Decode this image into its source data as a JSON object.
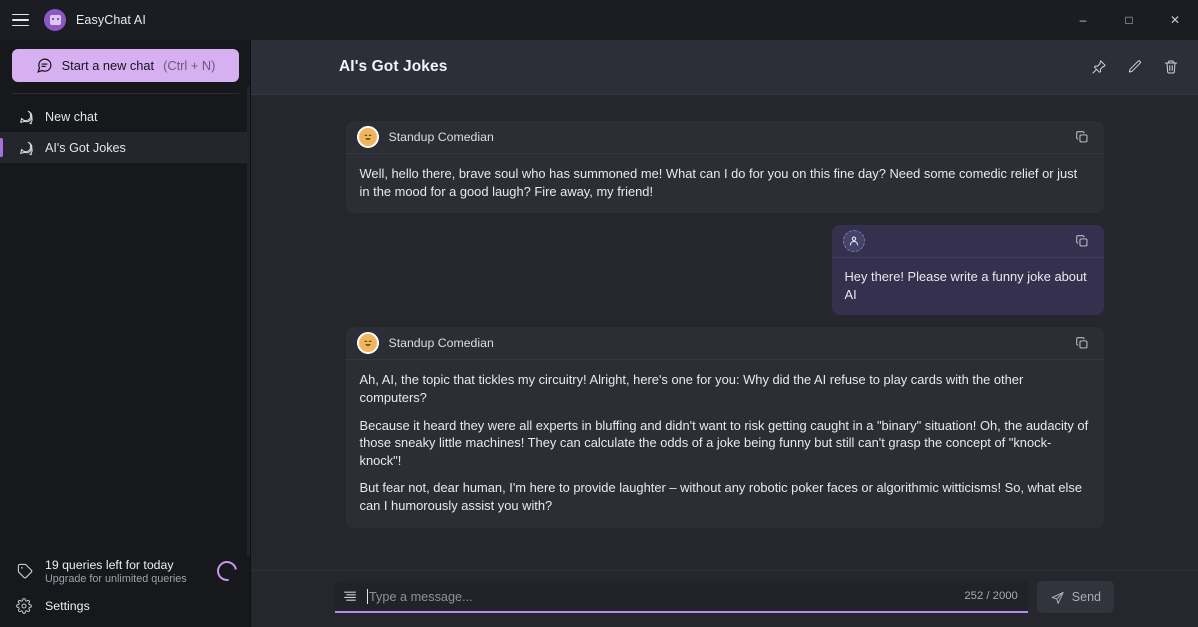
{
  "window": {
    "app_title": "EasyChat AI",
    "menu_icon": "hamburger-icon",
    "logo_icon": "app-logo-icon",
    "controls": {
      "minimize": "–",
      "maximize": "□",
      "close": "✕"
    }
  },
  "sidebar": {
    "new_chat_button": {
      "label": "Start a new chat",
      "shortcut": "(Ctrl + N)",
      "icon": "new-chat-bubble-icon",
      "background": "#d7b0f2"
    },
    "chats": [
      {
        "label": "New chat",
        "icon": "chat-bubble-icon",
        "active": false
      },
      {
        "label": "AI's Got Jokes",
        "icon": "chat-bubble-icon",
        "active": true
      }
    ],
    "quota": {
      "title": "19 queries left for today",
      "subtitle": "Upgrade for unlimited queries",
      "icon": "tag-icon",
      "spinner_icon": "loading-spinner-icon",
      "accent": "#c497ea"
    },
    "settings": {
      "label": "Settings",
      "icon": "gear-icon"
    },
    "active_indicator_color": "#a56fe0"
  },
  "main": {
    "header": {
      "title": "AI's Got Jokes",
      "actions": [
        {
          "name": "pin-icon",
          "title": "Pin"
        },
        {
          "name": "edit-icon",
          "title": "Rename"
        },
        {
          "name": "trash-icon",
          "title": "Delete"
        }
      ]
    },
    "messages": [
      {
        "role": "bot",
        "author": "Standup Comedian",
        "avatar_icon": "smiley-face-avatar",
        "copy_icon": "copy-icon",
        "paragraphs": [
          "Well, hello there, brave soul who has summoned me! What can I do for you on this fine day? Need some comedic relief or just in the mood for a good laugh? Fire away, my friend!"
        ]
      },
      {
        "role": "user",
        "author": "",
        "avatar_icon": "person-avatar-icon",
        "copy_icon": "copy-icon",
        "paragraphs": [
          "Hey there! Please write a funny joke about AI"
        ]
      },
      {
        "role": "bot",
        "author": "Standup Comedian",
        "avatar_icon": "smiley-face-avatar",
        "copy_icon": "copy-icon",
        "paragraphs": [
          "Ah, AI, the topic that tickles my circuitry! Alright, here's one for you: Why did the AI refuse to play cards with the other computers?",
          "Because it heard they were all experts in bluffing and didn't want to risk getting caught in a \"binary\" situation! Oh, the audacity of those sneaky little machines! They can calculate the odds of a joke being funny but still can't grasp the concept of \"knock-knock\"!",
          "But fear not, dear human, I'm here to provide laughter – without any robotic poker faces or algorithmic witticisms! So, what else can I humorously assist you with?"
        ]
      }
    ],
    "composer": {
      "prompt_icon": "prompt-library-icon",
      "placeholder": "Type a message...",
      "value": "",
      "counter": "252 / 2000",
      "send_label": "Send",
      "send_icon": "send-plane-icon",
      "underline_color": "#b98ae8"
    }
  }
}
